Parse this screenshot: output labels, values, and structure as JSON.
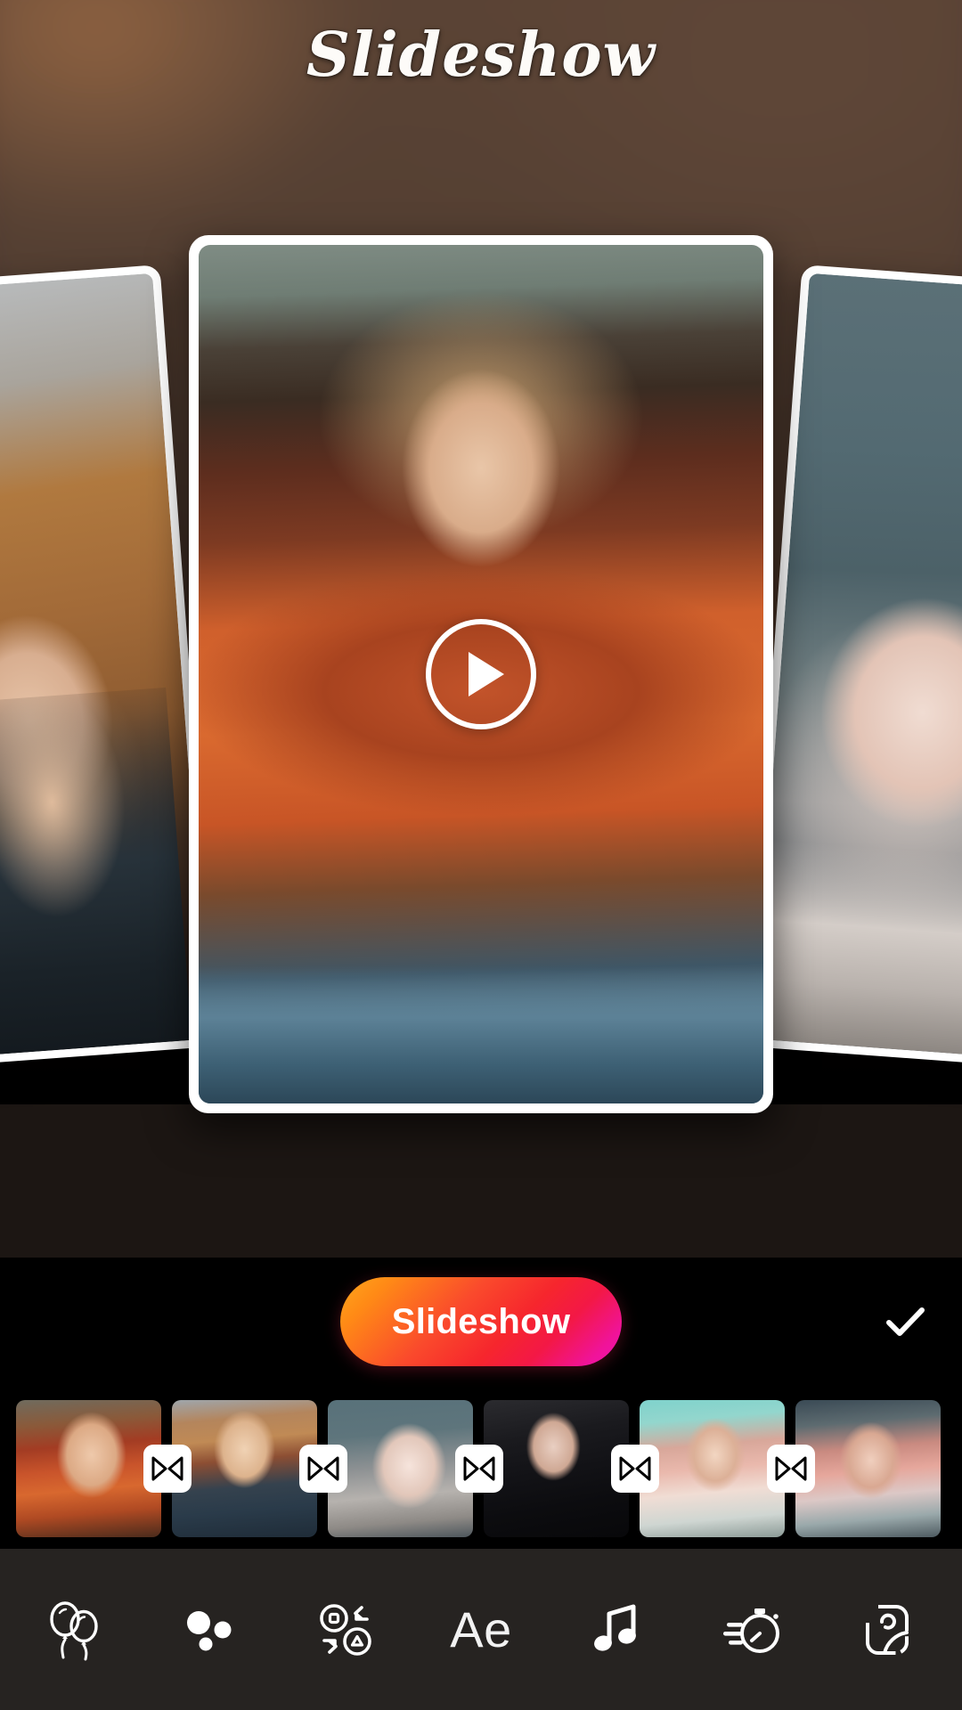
{
  "header": {
    "title": "Slideshow"
  },
  "preview": {
    "play_button_label": "Play",
    "cards": [
      {
        "name": "slide-left",
        "alt": "Blonde woman in dark top standing outdoors"
      },
      {
        "name": "slide-center",
        "alt": "Blonde woman in orange tie-front blouse"
      },
      {
        "name": "slide-right",
        "alt": "Smiling blonde woman in graphic tee"
      }
    ]
  },
  "action_bar": {
    "slideshow_label": "Slideshow",
    "confirm_icon": "check-icon",
    "gradient_start": "#ffa71b",
    "gradient_mid": "#f6262d",
    "gradient_end": "#ee12b0"
  },
  "filmstrip": {
    "clips": [
      {
        "label": "clip-1",
        "style": "t1"
      },
      {
        "label": "clip-2",
        "style": "t2"
      },
      {
        "label": "clip-3",
        "style": "t3"
      },
      {
        "label": "clip-4",
        "style": "t4"
      },
      {
        "label": "clip-5",
        "style": "t5"
      },
      {
        "label": "clip-6",
        "style": "t6"
      }
    ],
    "transition_icon": "bowtie-transition-icon",
    "transition_count": 5
  },
  "toolbar": {
    "items": [
      {
        "icon": "balloons-icon",
        "label": ""
      },
      {
        "icon": "bokeh-dots-icon",
        "label": ""
      },
      {
        "icon": "transition-swap-icon",
        "label": ""
      },
      {
        "icon": "text-ae-icon",
        "label": "Ae"
      },
      {
        "icon": "music-note-icon",
        "label": ""
      },
      {
        "icon": "speed-stopwatch-icon",
        "label": ""
      },
      {
        "icon": "canvas-photo-icon",
        "label": ""
      }
    ]
  }
}
